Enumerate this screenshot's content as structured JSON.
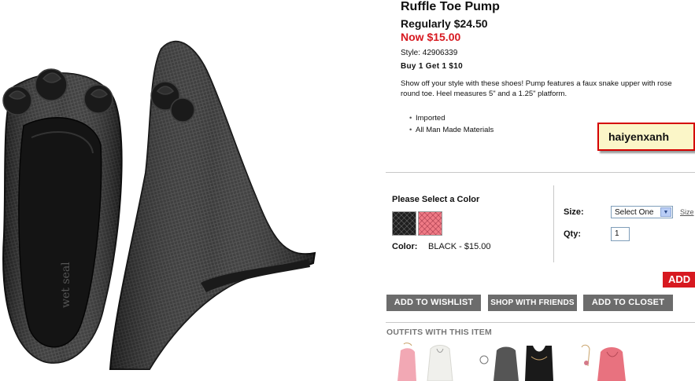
{
  "product": {
    "title": "Ruffle Toe Pump",
    "regular_price": "Regularly $24.50",
    "now_price": "Now $15.00",
    "style": "Style: 42906339",
    "promo": "Buy 1 Get 1 $10",
    "description_line1": "Show off your style with these shoes! Pump features a faux snake upper with rose",
    "description_line2": "round toe. Heel measures 5\" and a 1.25\" platform.",
    "features": [
      "Imported",
      "All Man Made Materials"
    ],
    "brand_imprint": "wet seal"
  },
  "watermark": {
    "text": "haiyenxanh"
  },
  "color_picker": {
    "title": "Please Select a Color",
    "swatches": [
      {
        "name": "black-swatch",
        "color": "#1e1e1e"
      },
      {
        "name": "pink-swatch",
        "color": "#f07b86"
      }
    ],
    "label": "Color:",
    "selected": "BLACK - $15.00"
  },
  "options": {
    "size_label": "Size:",
    "size_selected": "Select One",
    "size_chart": "Size",
    "qty_label": "Qty:",
    "qty_value": "1"
  },
  "actions": {
    "add": "ADD",
    "wishlist": "ADD TO WISHLIST",
    "shop_friends": "SHOP WITH FRIENDS",
    "closet": "ADD TO CLOSET"
  },
  "outfits": {
    "title": "OUTFITS WITH THIS ITEM"
  },
  "colors": {
    "sale_red": "#d71920",
    "button_gray": "#6c6c6c",
    "divider": "#c8c8c8"
  }
}
